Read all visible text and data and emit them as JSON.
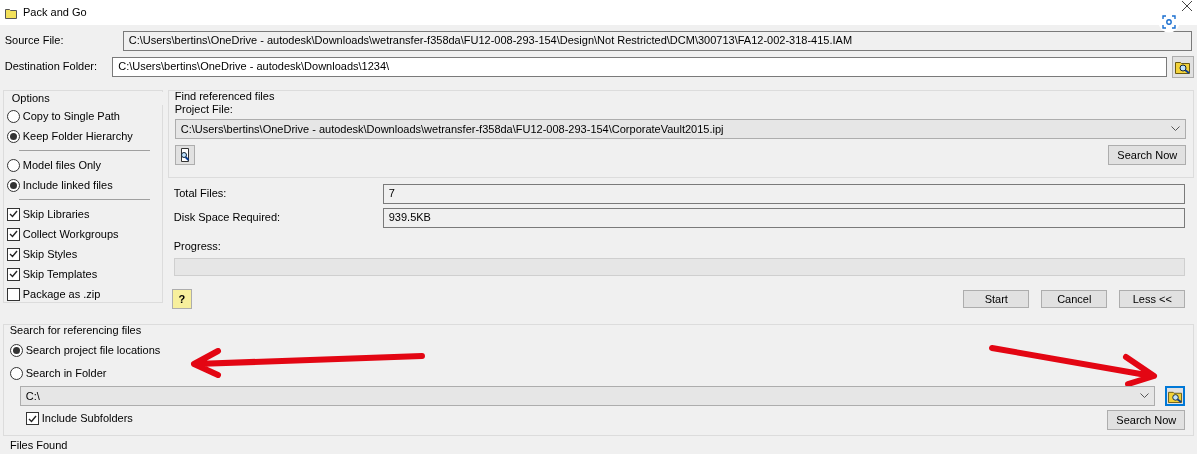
{
  "window": {
    "title": "Pack and Go"
  },
  "source_file": {
    "label": "Source File:",
    "value": "C:\\Users\\bertins\\OneDrive - autodesk\\Downloads\\wetransfer-f358da\\FU12-008-293-154\\Design\\Not Restricted\\DCM\\300713\\FA12-002-318-415.IAM"
  },
  "destination_folder": {
    "label": "Destination Folder:",
    "value": "C:\\Users\\bertins\\OneDrive - autodesk\\Downloads\\1234\\"
  },
  "options": {
    "title": "Options",
    "groups": [
      [
        {
          "kind": "radio",
          "label": "Copy to Single Path",
          "selected": false
        },
        {
          "kind": "radio",
          "label": "Keep Folder Hierarchy",
          "selected": true
        }
      ],
      [
        {
          "kind": "radio",
          "label": "Model files Only",
          "selected": false
        },
        {
          "kind": "radio",
          "label": "Include linked files",
          "selected": true
        }
      ],
      [
        {
          "kind": "checkbox",
          "label": "Skip Libraries",
          "checked": true
        },
        {
          "kind": "checkbox",
          "label": "Collect Workgroups",
          "checked": true
        },
        {
          "kind": "checkbox",
          "label": "Skip Styles",
          "checked": true
        },
        {
          "kind": "checkbox",
          "label": "Skip Templates",
          "checked": true
        },
        {
          "kind": "checkbox",
          "label": "Package as .zip",
          "checked": false
        }
      ]
    ]
  },
  "find_referenced": {
    "title": "Find referenced files",
    "project_file_label": "Project File:",
    "project_file": "C:\\Users\\bertins\\OneDrive - autodesk\\Downloads\\wetransfer-f358da\\FU12-008-293-154\\CorporateVault2015.ipj",
    "search_button": "Search Now"
  },
  "stats": [
    {
      "label": "Total Files:",
      "value": "7"
    },
    {
      "label": "Disk Space Required:",
      "value": "939.5KB"
    }
  ],
  "progress": {
    "label": "Progress:"
  },
  "help_button": "?",
  "buttons": [
    "Start",
    "Cancel",
    "Less <<"
  ],
  "search_referencing": {
    "title": "Search for referencing files",
    "options": [
      {
        "label": "Search project file locations",
        "selected": true
      },
      {
        "label": "Search in Folder",
        "selected": false
      }
    ],
    "folder": "C:\\",
    "include_subfolders": {
      "label": "Include Subfolders",
      "checked": true
    },
    "search_button": "Search Now"
  },
  "files_found": {
    "title": "Files Found"
  }
}
